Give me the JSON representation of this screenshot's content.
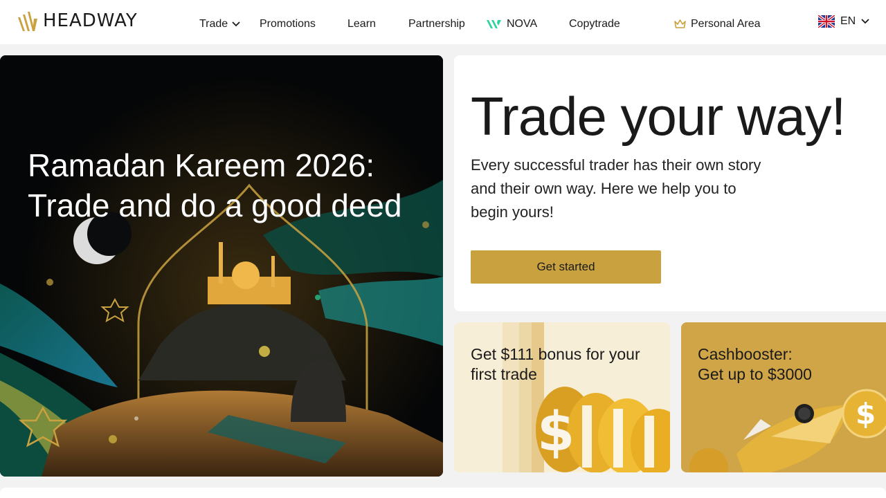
{
  "header": {
    "logo_text": "HEADWAY",
    "nav": {
      "trade": "Trade",
      "promotions": "Promotions",
      "learn": "Learn",
      "partnership": "Partnership",
      "nova": "NOVA",
      "copytrade": "Copytrade",
      "personal_area": "Personal Area"
    },
    "language": "EN"
  },
  "hero": {
    "left_title": "Ramadan Kareem 2026: Trade and do a good deed",
    "right_title": "Trade your way!",
    "right_subtitle": "Every successful trader has their own story and their own way. Here we help you to begin yours!",
    "cta_label": "Get started"
  },
  "cards": [
    {
      "title": "Get $111 bonus for your first trade"
    },
    {
      "title_line1": "Cashbooster:",
      "title_line2": "Get up to $3000"
    }
  ],
  "colors": {
    "accent": "#c9a23f",
    "nova_green": "#2bd49a",
    "header_bg": "#ffffff",
    "page_bg": "#f2f2f2"
  },
  "icons": [
    "headway-logo-icon",
    "chevron-down-icon",
    "nova-logo-icon",
    "crown-icon",
    "uk-flag-icon"
  ]
}
